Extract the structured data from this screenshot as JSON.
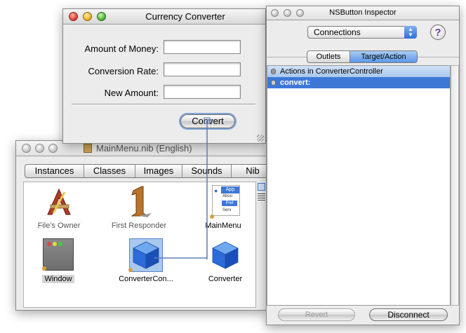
{
  "converter_window": {
    "title": "Currency Converter",
    "labels": [
      "Amount of Money:",
      "Conversion Rate:",
      "New Amount:"
    ],
    "fields": [
      "",
      "",
      ""
    ],
    "convert_button": "Convert"
  },
  "nib_window": {
    "title": "MainMenu.nib (English)",
    "tabs": [
      "Instances",
      "Classes",
      "Images",
      "Sounds",
      "Nib"
    ],
    "icons": [
      {
        "label": "File's Owner"
      },
      {
        "label": "First Responder"
      },
      {
        "label": "MainMenu"
      },
      {
        "label": "Window"
      },
      {
        "label": "ConverterCon..."
      },
      {
        "label": "Converter"
      }
    ],
    "menu_snippet": [
      "App",
      "Abou",
      "Pref",
      "Serv"
    ]
  },
  "inspector_window": {
    "title": "NSButton Inspector",
    "popup_value": "Connections",
    "help_label": "?",
    "tabs": [
      "Outlets",
      "Target/Action"
    ],
    "rows": [
      "Actions in ConverterController",
      "convert:"
    ],
    "revert_button": "Revert",
    "disconnect_button": "Disconnect"
  },
  "colors": {
    "selection": "#3d78d6",
    "selection_light": "#a9c8ee",
    "connection_line": "#5a7fb5"
  }
}
